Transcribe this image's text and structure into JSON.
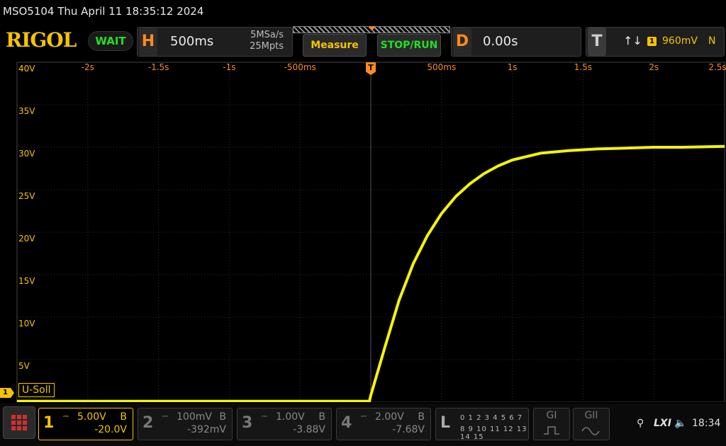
{
  "titlebar": {
    "text": "MSO5104  Thu April 11 18:35:12 2024"
  },
  "header": {
    "logo": "RIGOL",
    "run_state": "WAIT",
    "horizontal": {
      "letter": "H",
      "timebase": "500ms",
      "sample_rate": "5MSa/s",
      "memory_depth": "25Mpts"
    },
    "measure_label": "Measure",
    "stopstart_label": "STOP/RUN",
    "delay": {
      "letter": "D",
      "value": "0.00s"
    },
    "trigger": {
      "letter": "T",
      "slope": "↑↓",
      "source": "1",
      "level": "960mV",
      "mode": "N"
    }
  },
  "grid": {
    "x_ticks": [
      "-2s",
      "-1.5s",
      "-1s",
      "-500ms",
      "500ms",
      "1s",
      "1.5s",
      "2s",
      "2.5s"
    ],
    "y_ticks": [
      "40V",
      "35V",
      "30V",
      "25V",
      "20V",
      "15V",
      "10V",
      "5V"
    ],
    "trigger_marker": "T",
    "channel_marker": "1",
    "channel_label": "U-Soll"
  },
  "chart_data": {
    "type": "line",
    "title": "",
    "xlabel": "",
    "ylabel": "",
    "xlim": [
      -2.5,
      2.5
    ],
    "ylim": [
      0,
      40
    ],
    "grid": true,
    "series": [
      {
        "name": "U-Soll",
        "color": "#f5f500",
        "x": [
          -2.5,
          -0.01,
          0.0,
          0.1,
          0.2,
          0.3,
          0.4,
          0.5,
          0.6,
          0.7,
          0.8,
          0.9,
          1.0,
          1.2,
          1.4,
          1.6,
          1.8,
          2.0,
          2.2,
          2.5
        ],
        "y": [
          0.1,
          0.1,
          0.8,
          6.5,
          12.0,
          16.3,
          19.6,
          22.2,
          24.2,
          25.7,
          26.9,
          27.8,
          28.5,
          29.3,
          29.6,
          29.8,
          29.9,
          30.0,
          30.0,
          30.1
        ]
      }
    ]
  },
  "channels": [
    {
      "num": "1",
      "coupling": "DC",
      "scale": "5.00V",
      "bw": "B",
      "offset": "-20.0V",
      "active": true
    },
    {
      "num": "2",
      "coupling": "DC",
      "scale": "100mV",
      "bw": "B",
      "offset": "-392mV",
      "active": false
    },
    {
      "num": "3",
      "coupling": "DC",
      "scale": "1.00V",
      "bw": "B",
      "offset": "-3.88V",
      "active": false
    },
    {
      "num": "4",
      "coupling": "DC",
      "scale": "2.00V",
      "bw": "B",
      "offset": "-7.68V",
      "active": false
    }
  ],
  "logic": {
    "letter": "L",
    "row1": "0 1 2 3  4 5 6 7",
    "row2": "8 9 10 11 12 13 14 15"
  },
  "generators": [
    {
      "label": "GI"
    },
    {
      "label": "GII"
    }
  ],
  "status": {
    "usb": "⚲",
    "lxi": "LXI",
    "sound": "🔈",
    "time": "18:34"
  },
  "colors": {
    "ch1": "#f5c400",
    "trace": "#f5f500",
    "time_axis": "#ff8a1e",
    "run_green": "#22e022"
  }
}
